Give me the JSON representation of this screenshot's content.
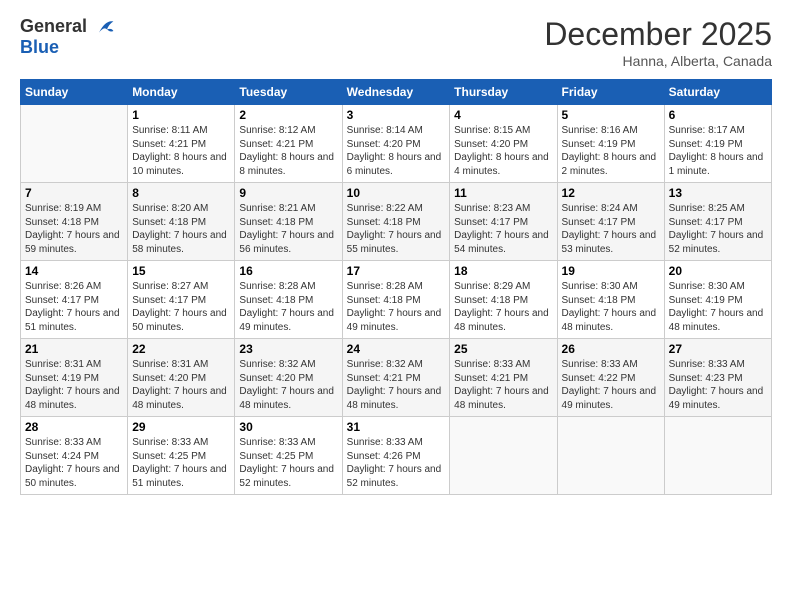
{
  "logo": {
    "general": "General",
    "blue": "Blue"
  },
  "header": {
    "month": "December 2025",
    "location": "Hanna, Alberta, Canada"
  },
  "weekdays": [
    "Sunday",
    "Monday",
    "Tuesday",
    "Wednesday",
    "Thursday",
    "Friday",
    "Saturday"
  ],
  "weeks": [
    [
      {
        "day": "",
        "sunrise": "",
        "sunset": "",
        "daylight": ""
      },
      {
        "day": "1",
        "sunrise": "Sunrise: 8:11 AM",
        "sunset": "Sunset: 4:21 PM",
        "daylight": "Daylight: 8 hours and 10 minutes."
      },
      {
        "day": "2",
        "sunrise": "Sunrise: 8:12 AM",
        "sunset": "Sunset: 4:21 PM",
        "daylight": "Daylight: 8 hours and 8 minutes."
      },
      {
        "day": "3",
        "sunrise": "Sunrise: 8:14 AM",
        "sunset": "Sunset: 4:20 PM",
        "daylight": "Daylight: 8 hours and 6 minutes."
      },
      {
        "day": "4",
        "sunrise": "Sunrise: 8:15 AM",
        "sunset": "Sunset: 4:20 PM",
        "daylight": "Daylight: 8 hours and 4 minutes."
      },
      {
        "day": "5",
        "sunrise": "Sunrise: 8:16 AM",
        "sunset": "Sunset: 4:19 PM",
        "daylight": "Daylight: 8 hours and 2 minutes."
      },
      {
        "day": "6",
        "sunrise": "Sunrise: 8:17 AM",
        "sunset": "Sunset: 4:19 PM",
        "daylight": "Daylight: 8 hours and 1 minute."
      }
    ],
    [
      {
        "day": "7",
        "sunrise": "Sunrise: 8:19 AM",
        "sunset": "Sunset: 4:18 PM",
        "daylight": "Daylight: 7 hours and 59 minutes."
      },
      {
        "day": "8",
        "sunrise": "Sunrise: 8:20 AM",
        "sunset": "Sunset: 4:18 PM",
        "daylight": "Daylight: 7 hours and 58 minutes."
      },
      {
        "day": "9",
        "sunrise": "Sunrise: 8:21 AM",
        "sunset": "Sunset: 4:18 PM",
        "daylight": "Daylight: 7 hours and 56 minutes."
      },
      {
        "day": "10",
        "sunrise": "Sunrise: 8:22 AM",
        "sunset": "Sunset: 4:18 PM",
        "daylight": "Daylight: 7 hours and 55 minutes."
      },
      {
        "day": "11",
        "sunrise": "Sunrise: 8:23 AM",
        "sunset": "Sunset: 4:17 PM",
        "daylight": "Daylight: 7 hours and 54 minutes."
      },
      {
        "day": "12",
        "sunrise": "Sunrise: 8:24 AM",
        "sunset": "Sunset: 4:17 PM",
        "daylight": "Daylight: 7 hours and 53 minutes."
      },
      {
        "day": "13",
        "sunrise": "Sunrise: 8:25 AM",
        "sunset": "Sunset: 4:17 PM",
        "daylight": "Daylight: 7 hours and 52 minutes."
      }
    ],
    [
      {
        "day": "14",
        "sunrise": "Sunrise: 8:26 AM",
        "sunset": "Sunset: 4:17 PM",
        "daylight": "Daylight: 7 hours and 51 minutes."
      },
      {
        "day": "15",
        "sunrise": "Sunrise: 8:27 AM",
        "sunset": "Sunset: 4:17 PM",
        "daylight": "Daylight: 7 hours and 50 minutes."
      },
      {
        "day": "16",
        "sunrise": "Sunrise: 8:28 AM",
        "sunset": "Sunset: 4:18 PM",
        "daylight": "Daylight: 7 hours and 49 minutes."
      },
      {
        "day": "17",
        "sunrise": "Sunrise: 8:28 AM",
        "sunset": "Sunset: 4:18 PM",
        "daylight": "Daylight: 7 hours and 49 minutes."
      },
      {
        "day": "18",
        "sunrise": "Sunrise: 8:29 AM",
        "sunset": "Sunset: 4:18 PM",
        "daylight": "Daylight: 7 hours and 48 minutes."
      },
      {
        "day": "19",
        "sunrise": "Sunrise: 8:30 AM",
        "sunset": "Sunset: 4:18 PM",
        "daylight": "Daylight: 7 hours and 48 minutes."
      },
      {
        "day": "20",
        "sunrise": "Sunrise: 8:30 AM",
        "sunset": "Sunset: 4:19 PM",
        "daylight": "Daylight: 7 hours and 48 minutes."
      }
    ],
    [
      {
        "day": "21",
        "sunrise": "Sunrise: 8:31 AM",
        "sunset": "Sunset: 4:19 PM",
        "daylight": "Daylight: 7 hours and 48 minutes."
      },
      {
        "day": "22",
        "sunrise": "Sunrise: 8:31 AM",
        "sunset": "Sunset: 4:20 PM",
        "daylight": "Daylight: 7 hours and 48 minutes."
      },
      {
        "day": "23",
        "sunrise": "Sunrise: 8:32 AM",
        "sunset": "Sunset: 4:20 PM",
        "daylight": "Daylight: 7 hours and 48 minutes."
      },
      {
        "day": "24",
        "sunrise": "Sunrise: 8:32 AM",
        "sunset": "Sunset: 4:21 PM",
        "daylight": "Daylight: 7 hours and 48 minutes."
      },
      {
        "day": "25",
        "sunrise": "Sunrise: 8:33 AM",
        "sunset": "Sunset: 4:21 PM",
        "daylight": "Daylight: 7 hours and 48 minutes."
      },
      {
        "day": "26",
        "sunrise": "Sunrise: 8:33 AM",
        "sunset": "Sunset: 4:22 PM",
        "daylight": "Daylight: 7 hours and 49 minutes."
      },
      {
        "day": "27",
        "sunrise": "Sunrise: 8:33 AM",
        "sunset": "Sunset: 4:23 PM",
        "daylight": "Daylight: 7 hours and 49 minutes."
      }
    ],
    [
      {
        "day": "28",
        "sunrise": "Sunrise: 8:33 AM",
        "sunset": "Sunset: 4:24 PM",
        "daylight": "Daylight: 7 hours and 50 minutes."
      },
      {
        "day": "29",
        "sunrise": "Sunrise: 8:33 AM",
        "sunset": "Sunset: 4:25 PM",
        "daylight": "Daylight: 7 hours and 51 minutes."
      },
      {
        "day": "30",
        "sunrise": "Sunrise: 8:33 AM",
        "sunset": "Sunset: 4:25 PM",
        "daylight": "Daylight: 7 hours and 52 minutes."
      },
      {
        "day": "31",
        "sunrise": "Sunrise: 8:33 AM",
        "sunset": "Sunset: 4:26 PM",
        "daylight": "Daylight: 7 hours and 52 minutes."
      },
      {
        "day": "",
        "sunrise": "",
        "sunset": "",
        "daylight": ""
      },
      {
        "day": "",
        "sunrise": "",
        "sunset": "",
        "daylight": ""
      },
      {
        "day": "",
        "sunrise": "",
        "sunset": "",
        "daylight": ""
      }
    ]
  ]
}
